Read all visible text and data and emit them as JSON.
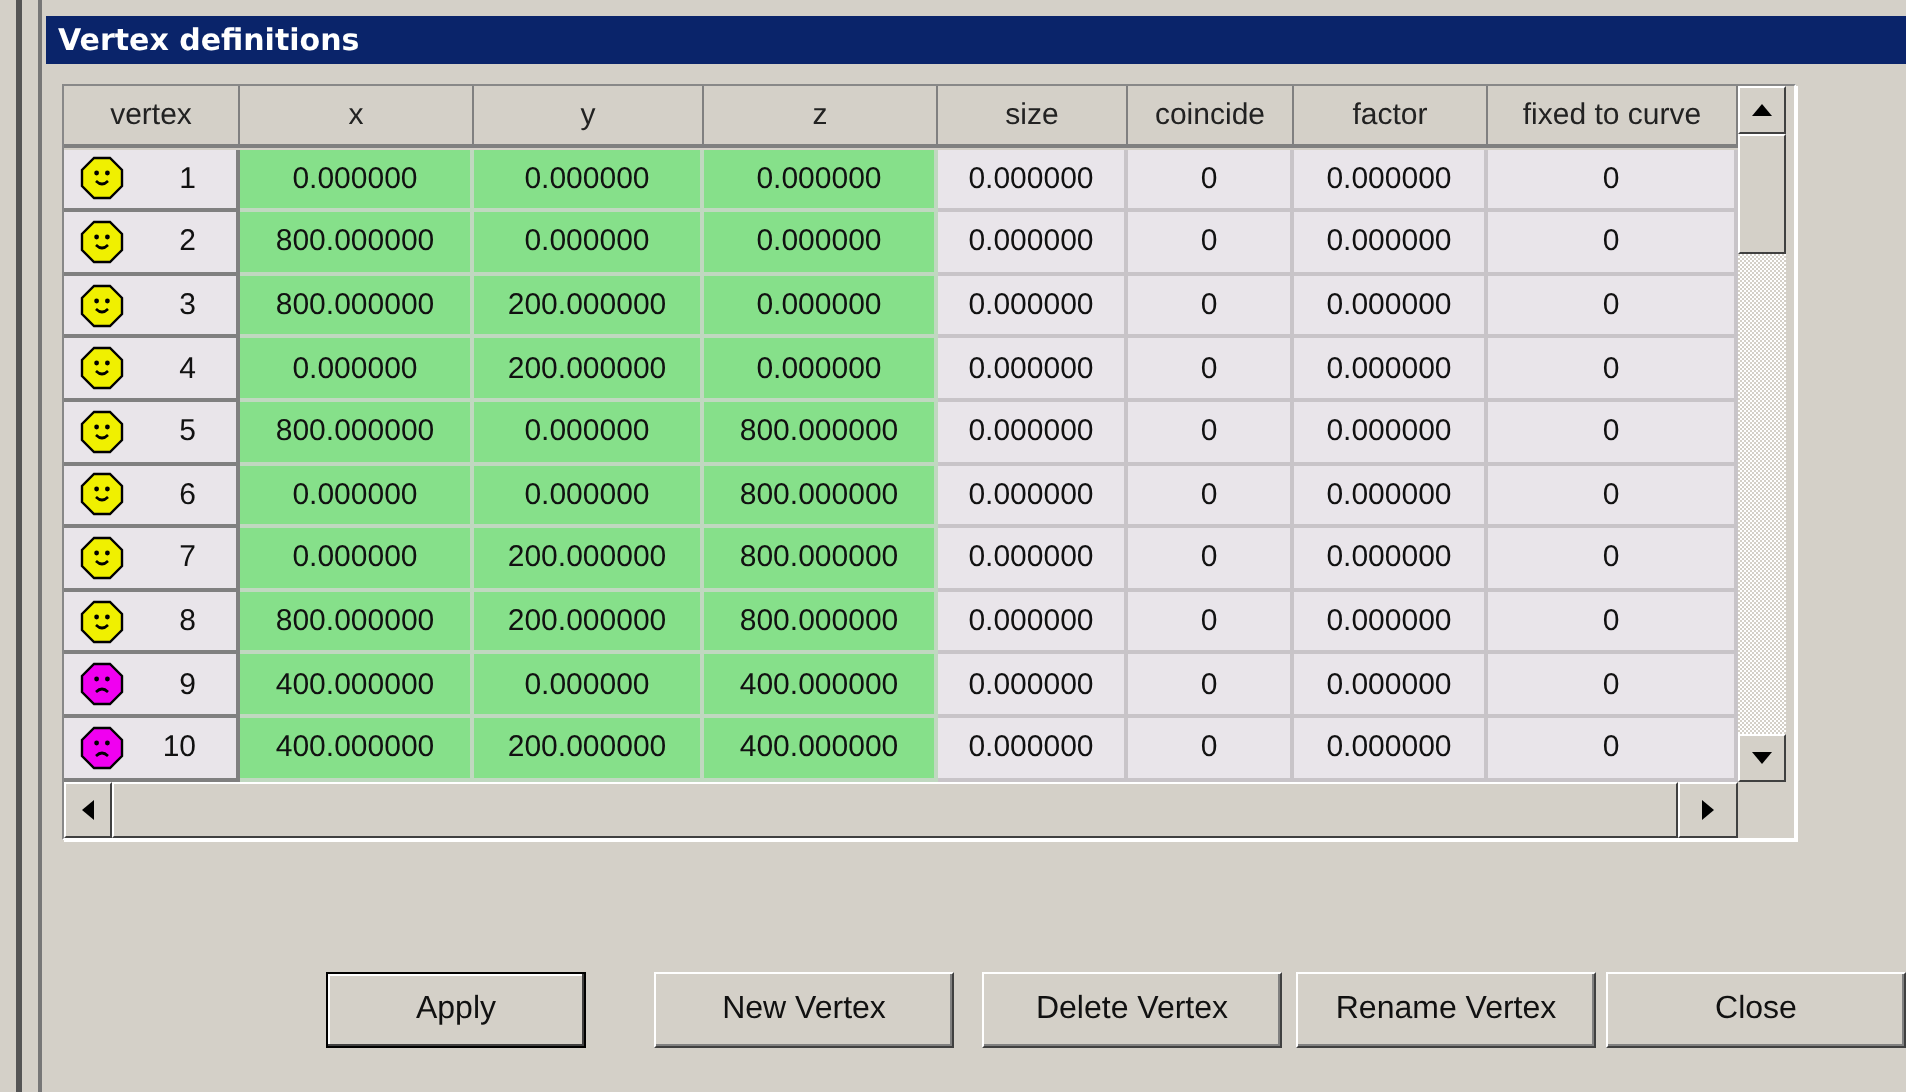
{
  "window": {
    "title": "Vertex definitions"
  },
  "table": {
    "columns": [
      {
        "label": "vertex",
        "highlighted": false
      },
      {
        "label": "x",
        "highlighted": true
      },
      {
        "label": "y",
        "highlighted": true
      },
      {
        "label": "z",
        "highlighted": true
      },
      {
        "label": "size",
        "highlighted": false
      },
      {
        "label": "coincide",
        "highlighted": false
      },
      {
        "label": "factor",
        "highlighted": false
      },
      {
        "label": "fixed to curve",
        "highlighted": false
      }
    ],
    "rows": [
      {
        "valid": true,
        "cells": [
          "1",
          "0.000000",
          "0.000000",
          "0.000000",
          "0.000000",
          "0",
          "0.000000",
          "0"
        ]
      },
      {
        "valid": true,
        "cells": [
          "2",
          "800.000000",
          "0.000000",
          "0.000000",
          "0.000000",
          "0",
          "0.000000",
          "0"
        ]
      },
      {
        "valid": true,
        "cells": [
          "3",
          "800.000000",
          "200.000000",
          "0.000000",
          "0.000000",
          "0",
          "0.000000",
          "0"
        ]
      },
      {
        "valid": true,
        "cells": [
          "4",
          "0.000000",
          "200.000000",
          "0.000000",
          "0.000000",
          "0",
          "0.000000",
          "0"
        ]
      },
      {
        "valid": true,
        "cells": [
          "5",
          "800.000000",
          "0.000000",
          "800.000000",
          "0.000000",
          "0",
          "0.000000",
          "0"
        ]
      },
      {
        "valid": true,
        "cells": [
          "6",
          "0.000000",
          "0.000000",
          "800.000000",
          "0.000000",
          "0",
          "0.000000",
          "0"
        ]
      },
      {
        "valid": true,
        "cells": [
          "7",
          "0.000000",
          "200.000000",
          "800.000000",
          "0.000000",
          "0",
          "0.000000",
          "0"
        ]
      },
      {
        "valid": true,
        "cells": [
          "8",
          "800.000000",
          "200.000000",
          "800.000000",
          "0.000000",
          "0",
          "0.000000",
          "0"
        ]
      },
      {
        "valid": false,
        "cells": [
          "9",
          "400.000000",
          "0.000000",
          "400.000000",
          "0.000000",
          "0",
          "0.000000",
          "0"
        ]
      },
      {
        "valid": false,
        "cells": [
          "10",
          "400.000000",
          "200.000000",
          "400.000000",
          "0.000000",
          "0",
          "0.000000",
          "0"
        ]
      }
    ]
  },
  "buttons": [
    "Apply",
    "New Vertex",
    "Delete Vertex",
    "Rename Vertex",
    "Close"
  ]
}
